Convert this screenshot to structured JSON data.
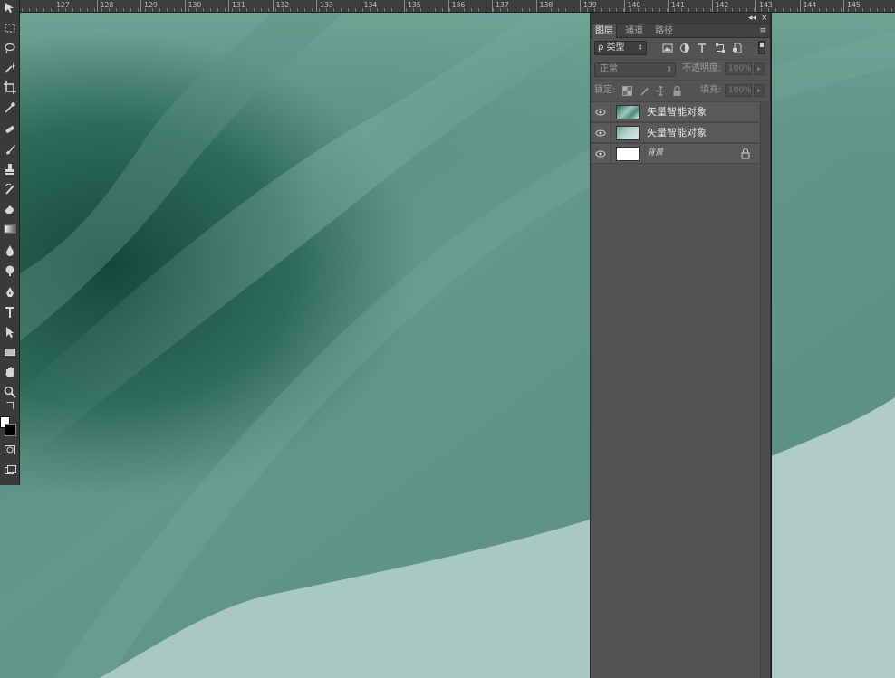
{
  "ruler": {
    "labels": [
      "127",
      "128",
      "129",
      "130",
      "131",
      "132",
      "133",
      "134",
      "135",
      "136",
      "137",
      "138",
      "139",
      "140",
      "141",
      "142",
      "143",
      "144",
      "145"
    ]
  },
  "toolbar": {
    "tools": [
      "move-icon",
      "marquee-icon",
      "lasso-icon",
      "magic-wand-icon",
      "crop-icon",
      "eyedropper-icon",
      "spot-healing-icon",
      "brush-icon",
      "clone-stamp-icon",
      "history-brush-icon",
      "eraser-icon",
      "gradient-icon",
      "blur-icon",
      "dodge-icon",
      "pen-icon",
      "type-icon",
      "path-selection-icon",
      "rectangle-shape-icon",
      "hand-icon",
      "zoom-icon"
    ],
    "foreground_color": "#ffffff",
    "background_color": "#000000"
  },
  "layers_panel": {
    "topbar": {
      "collapse": "◂◂",
      "close": "×"
    },
    "tabs": [
      {
        "label": "图层",
        "active": true
      },
      {
        "label": "通道",
        "active": false
      },
      {
        "label": "路径",
        "active": false
      }
    ],
    "menu_icon": "≡",
    "filter": {
      "search_symbol": "ρ",
      "kind_label": "类型",
      "icons": [
        "image-filter-icon",
        "adjustment-filter-icon",
        "type-filter-icon",
        "shape-filter-icon",
        "smart-object-filter-icon"
      ]
    },
    "blend_mode": "正常",
    "opacity": {
      "label": "不透明度:",
      "value": "100%"
    },
    "lock": {
      "label": "锁定:",
      "icons": [
        "lock-transparent-icon",
        "lock-image-icon",
        "lock-position-icon",
        "lock-all-icon"
      ]
    },
    "fill": {
      "label": "填充:",
      "value": "100%"
    },
    "layers": [
      {
        "name": "矢量智能对象",
        "visible": true,
        "locked": false,
        "italic": false
      },
      {
        "name": "矢量智能对象",
        "visible": true,
        "locked": false,
        "italic": false
      },
      {
        "name": "背景",
        "visible": true,
        "locked": true,
        "italic": true
      }
    ]
  },
  "colors": {
    "canvas_teal": "#5f9283",
    "canvas_dark": "#1e5a4b",
    "canvas_light": "#a8c7c0",
    "panel_bg": "#535353"
  }
}
